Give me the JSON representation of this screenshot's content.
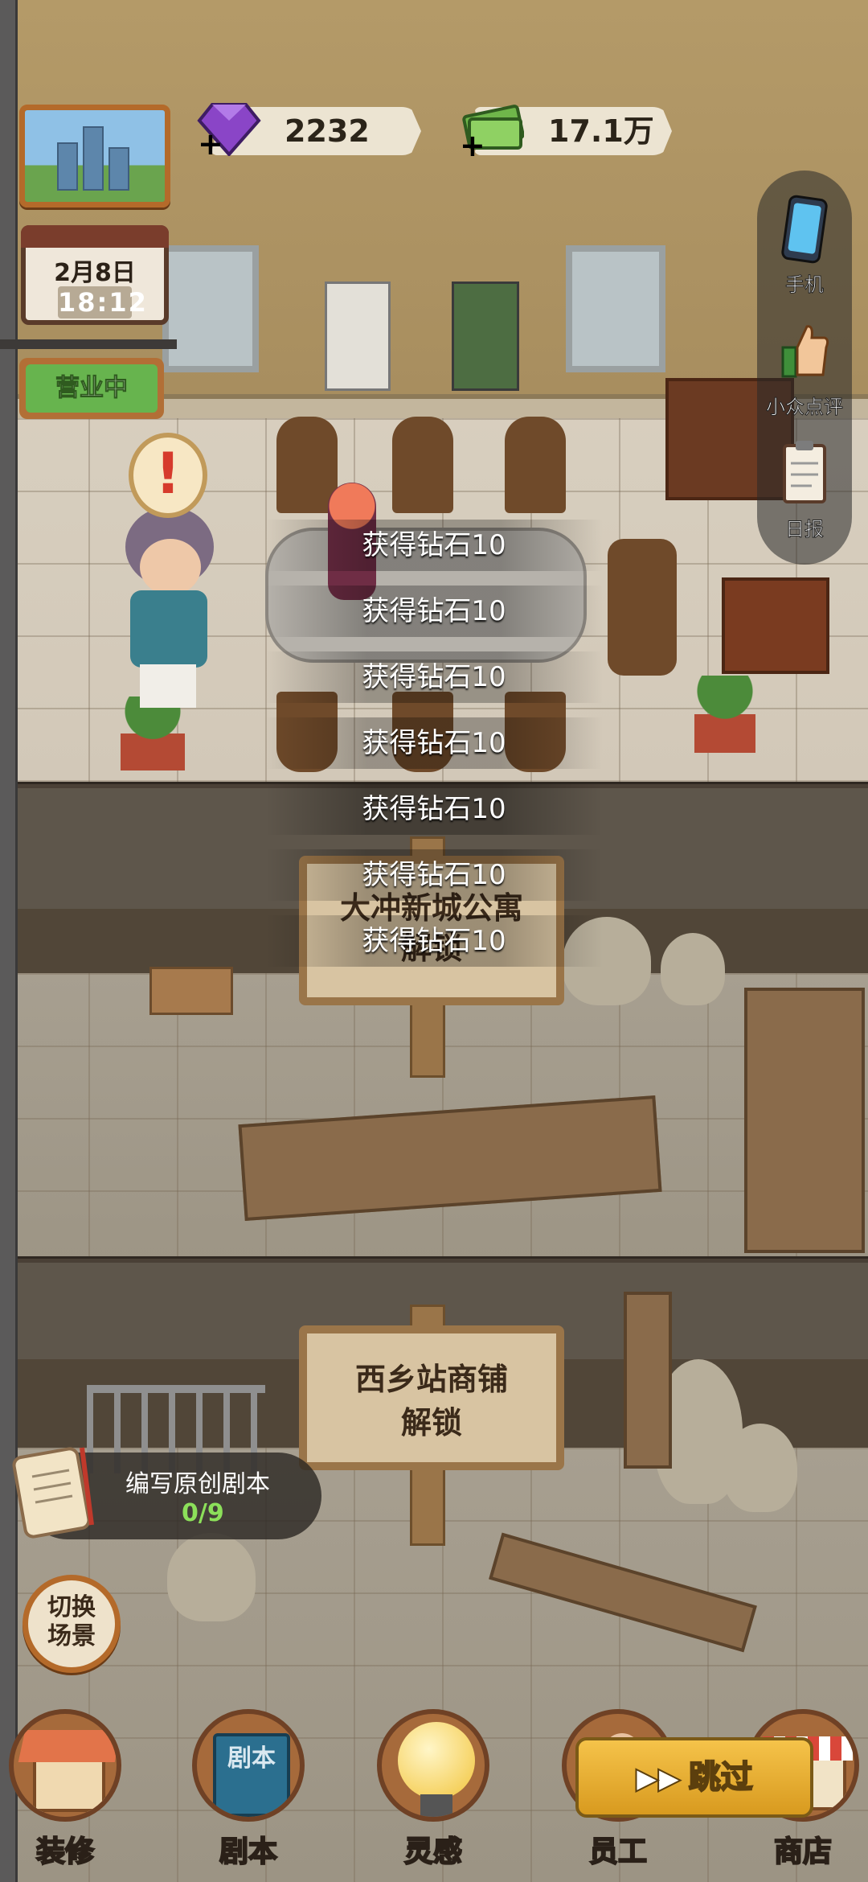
{
  "hud": {
    "gems": "2232",
    "cash": "17.1万",
    "plus": "+",
    "date": "2月8日",
    "time": "18:12",
    "status_sign": "营业中"
  },
  "right_panel": {
    "items": [
      {
        "label": "手机",
        "icon": "phone-icon"
      },
      {
        "label": "小众点评",
        "icon": "thumbs-up-icon"
      },
      {
        "label": "日报",
        "icon": "clipboard-icon"
      }
    ]
  },
  "toasts": [
    "获得钻石10",
    "获得钻石10",
    "获得钻石10",
    "获得钻石10",
    "获得钻石10",
    "获得钻石10",
    "获得钻石10"
  ],
  "locked_floors": [
    {
      "name": "大冲新城公寓",
      "action": "解锁"
    },
    {
      "name": "西乡站商铺",
      "action": "解锁"
    }
  ],
  "task": {
    "title": "编写原创剧本",
    "progress": "0/9"
  },
  "switch_scene": {
    "label_line1": "切换",
    "label_line2": "场景"
  },
  "bottom_nav": [
    {
      "label": "装修",
      "icon": "house-icon"
    },
    {
      "label": "剧本",
      "icon": "script-book-icon"
    },
    {
      "label": "灵感",
      "icon": "lightbulb-icon"
    },
    {
      "label": "员工",
      "icon": "staff-icon"
    },
    {
      "label": "商店",
      "icon": "shop-icon"
    }
  ],
  "script_book_cover": "剧本",
  "skip_button": "跳过",
  "colors": {
    "accent": "#d89a1f",
    "open_sign": "#67b44e",
    "task_progress": "#8ce05a"
  }
}
